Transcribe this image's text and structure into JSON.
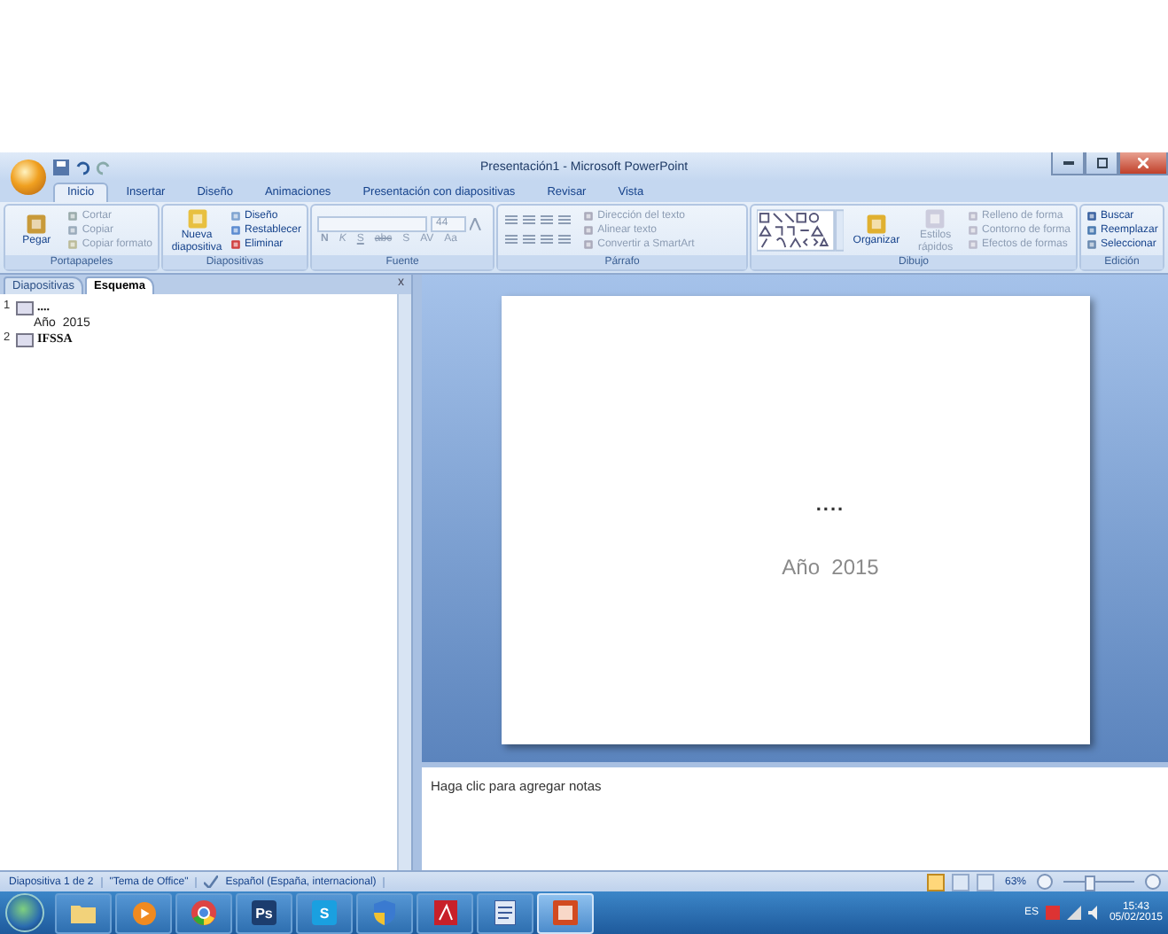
{
  "window": {
    "title": "Presentación1 - Microsoft PowerPoint"
  },
  "tabs": [
    {
      "label": "Inicio",
      "selected": true
    },
    {
      "label": "Insertar",
      "selected": false
    },
    {
      "label": "Diseño",
      "selected": false
    },
    {
      "label": "Animaciones",
      "selected": false
    },
    {
      "label": "Presentación con diapositivas",
      "selected": false
    },
    {
      "label": "Revisar",
      "selected": false
    },
    {
      "label": "Vista",
      "selected": false
    }
  ],
  "ribbon": {
    "groups": [
      {
        "label": "Portapapeles",
        "kind": "standard",
        "large": [
          {
            "label": "Pegar",
            "disabled": false
          }
        ],
        "small": [
          {
            "label": "Cortar",
            "disabled": true
          },
          {
            "label": "Copiar",
            "disabled": true
          },
          {
            "label": "Copiar formato",
            "disabled": true
          }
        ]
      },
      {
        "label": "Diapositivas",
        "kind": "standard",
        "large": [
          {
            "label": "Nueva diapositiva",
            "disabled": false
          }
        ],
        "small": [
          {
            "label": "Diseño",
            "disabled": false
          },
          {
            "label": "Restablecer",
            "disabled": false
          },
          {
            "label": "Eliminar",
            "disabled": false
          }
        ]
      },
      {
        "label": "Fuente",
        "kind": "font",
        "size": "44",
        "buttons": [
          "N",
          "K",
          "S",
          "abc",
          "S",
          "AV",
          "Aa"
        ]
      },
      {
        "label": "Párrafo",
        "kind": "paragraph",
        "small": [
          {
            "label": "Dirección del texto",
            "disabled": true
          },
          {
            "label": "Alinear texto",
            "disabled": true
          },
          {
            "label": "Convertir a SmartArt",
            "disabled": true
          }
        ]
      },
      {
        "label": "Dibujo",
        "kind": "drawing",
        "large": [
          {
            "label": "Organizar",
            "disabled": false
          },
          {
            "label": "Estilos rápidos",
            "disabled": true
          }
        ],
        "small": [
          {
            "label": "Relleno de forma",
            "disabled": true
          },
          {
            "label": "Contorno de forma",
            "disabled": true
          },
          {
            "label": "Efectos de formas",
            "disabled": true
          }
        ]
      },
      {
        "label": "Edición",
        "kind": "standard",
        "small": [
          {
            "label": "Buscar",
            "disabled": false
          },
          {
            "label": "Reemplazar",
            "disabled": false
          },
          {
            "label": "Seleccionar",
            "disabled": false
          }
        ]
      }
    ]
  },
  "pane": {
    "tabs": [
      {
        "label": "Diapositivas",
        "selected": false
      },
      {
        "label": "Esquema",
        "selected": true
      }
    ],
    "close": "x",
    "outline": [
      {
        "number": "1",
        "title": "....",
        "lines": [
          "Año  2015"
        ]
      },
      {
        "number": "2",
        "title": "IFSSA"
      }
    ]
  },
  "slide": {
    "title": "....",
    "subtitle": "Año  2015"
  },
  "notes": {
    "placeholder": "Haga clic para agregar notas"
  },
  "status_bar": {
    "items": [
      "Diapositiva 1 de 2",
      "\"Tema de Office\"",
      "Español (España, internacional)"
    ],
    "views": [
      {
        "selected": true
      },
      {
        "selected": false
      },
      {
        "selected": false
      }
    ],
    "zoom": "63%",
    "level": 0.35
  },
  "taskbar": {
    "apps": [
      {
        "kind": "folder",
        "open": false
      },
      {
        "kind": "media",
        "open": false
      },
      {
        "kind": "chrome",
        "open": false
      },
      {
        "kind": "tile",
        "label": "Ps",
        "color": "#1c3d6e",
        "open": false
      },
      {
        "kind": "tile",
        "label": "S",
        "color": "#1aa0e0",
        "open": false
      },
      {
        "kind": "shield",
        "open": false
      },
      {
        "kind": "acrobat",
        "open": false
      },
      {
        "kind": "document",
        "open": false
      },
      {
        "kind": "powerpoint",
        "open": true
      }
    ],
    "language": "ES",
    "time": "15:43",
    "date": "05/02/2015"
  }
}
